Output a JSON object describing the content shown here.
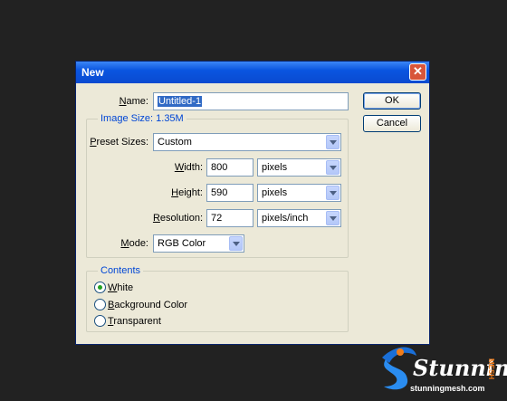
{
  "dialog": {
    "title": "New",
    "close_label": "✕",
    "ok_label": "OK",
    "cancel_label": "Cancel",
    "name_label": "Name:",
    "name_value": "Untitled-1",
    "image_size_legend": "Image Size: 1.35M",
    "preset_label": "Preset Sizes:",
    "preset_value": "Custom",
    "width_label": "Width:",
    "width_value": "800",
    "width_unit": "pixels",
    "height_label": "Height:",
    "height_value": "590",
    "height_unit": "pixels",
    "resolution_label": "Resolution:",
    "resolution_value": "72",
    "resolution_unit": "pixels/inch",
    "mode_label": "Mode:",
    "mode_value": "RGB Color",
    "contents_legend": "Contents",
    "contents_options": [
      "White",
      "Background Color",
      "Transparent"
    ],
    "contents_selected": "White"
  },
  "watermark": {
    "brand": "Stunning",
    "brand_suffix": "MESH",
    "url": "stunningmesh.com"
  }
}
